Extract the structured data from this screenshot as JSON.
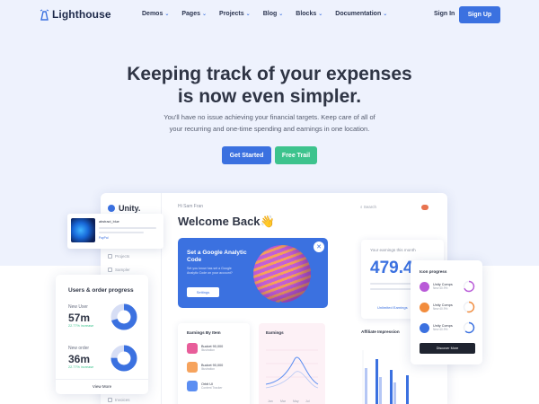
{
  "brand": {
    "name": "Lighthouse"
  },
  "nav": {
    "items": [
      {
        "label": "Demos"
      },
      {
        "label": "Pages"
      },
      {
        "label": "Projects"
      },
      {
        "label": "Blog"
      },
      {
        "label": "Blocks"
      },
      {
        "label": "Documentation"
      }
    ],
    "signin": "Sign In",
    "signup": "Sign Up"
  },
  "hero": {
    "title_line1": "Keeping track of your expenses",
    "title_line2": "is now even simpler.",
    "subtitle_line1": "You'll have no issue achieving your financial targets. Keep care of all of",
    "subtitle_line2": "your recurring and one-time spending and earnings in one location.",
    "cta_primary": "Get Started",
    "cta_secondary": "Free Trail"
  },
  "dashboard": {
    "brand": "Unity.",
    "greeting": "Hi Sam Fran",
    "welcome": "Welcome Back👋",
    "search": "Search",
    "sidebar": [
      "Dashboard",
      "Projects",
      "Sampler",
      "Schedule",
      "Invoices"
    ],
    "promo": {
      "title": "Set a Google Analytic Code",
      "desc": "Set you know has set a Google Analytic Code on your account?",
      "button": "Settings"
    },
    "earnings": {
      "label": "Your earnings this month",
      "value": "479.4",
      "link": "Unlimited Earnings"
    },
    "earnings_team": {
      "title": "Earnings By Item",
      "rows": [
        {
          "name": "Bucket 90,000",
          "sub": "Illustration",
          "color": "#e85d9a"
        },
        {
          "name": "Bucket 90,000",
          "sub": "Illustration",
          "color": "#f6a35d"
        },
        {
          "name": "Orbit UI",
          "sub": "Content Tracker",
          "color": "#5b8ef2"
        }
      ]
    },
    "earnings_chart": {
      "title": "Earnings",
      "ticks": [
        "Jan",
        "Mar",
        "May",
        "Jul"
      ]
    },
    "affiliate_title": "Affiliate Impression"
  },
  "popup": {
    "title": "abstract_blue",
    "tag": "PayPal"
  },
  "users_card": {
    "title": "Users & order progress",
    "new_user_label": "New User",
    "new_user_value": "57m",
    "new_user_increase": "22.77% increase",
    "new_order_label": "New order",
    "new_order_value": "36m",
    "new_order_increase": "22.77% increase",
    "view_more": "View More",
    "new_user_fraction": 0.7,
    "new_order_fraction": 0.75,
    "primary_color": "#3b71e0",
    "track_color": "#d7def5"
  },
  "icon_card": {
    "title": "Icon progress",
    "rows": [
      {
        "name": "Unity Comps",
        "sub": "New 40.9%",
        "color": "#b95ad8",
        "percent": 0.68
      },
      {
        "name": "Unity Comps",
        "sub": "New 40.9%",
        "color": "#f28c3d",
        "percent": 0.55
      },
      {
        "name": "Unity Comps",
        "sub": "New 40.9%",
        "color": "#3b71e0",
        "percent": 0.62
      }
    ],
    "button": "Discover More"
  }
}
